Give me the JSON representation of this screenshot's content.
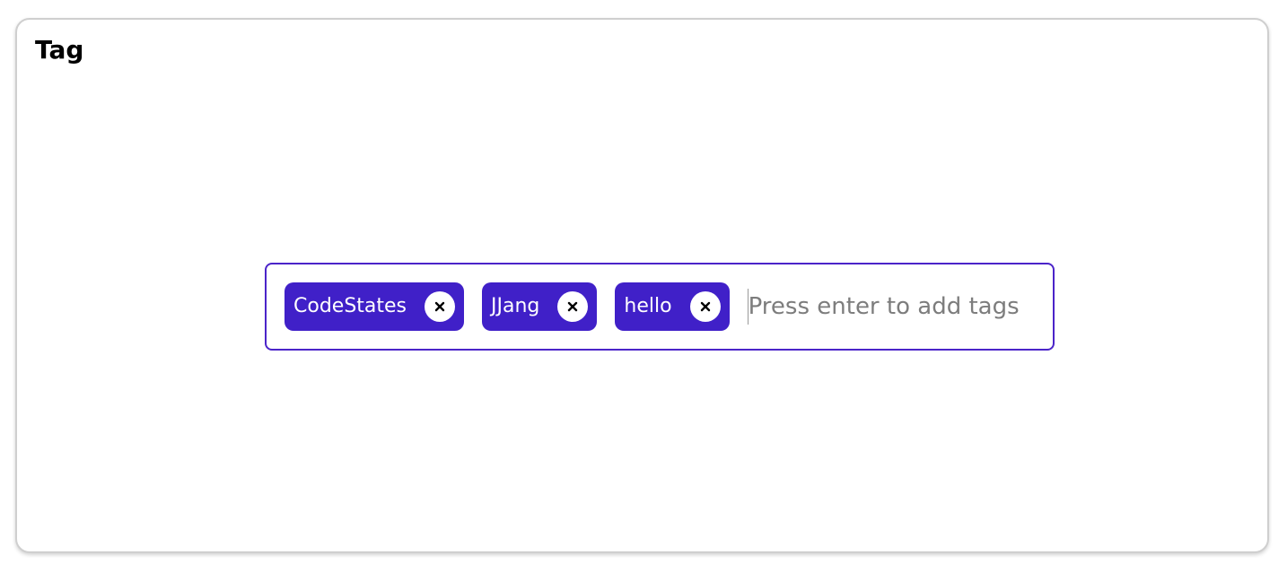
{
  "card": {
    "title": "Tag"
  },
  "tag_input": {
    "tags": [
      {
        "label": "CodeStates",
        "remove_icon": "close-icon"
      },
      {
        "label": "JJang",
        "remove_icon": "close-icon"
      },
      {
        "label": "hello",
        "remove_icon": "close-icon"
      }
    ],
    "placeholder": "Press enter to add tags",
    "value": ""
  },
  "colors": {
    "accent": "#4020c8",
    "border": "#4b24c9",
    "card_border": "#cfcfcf",
    "placeholder": "#7d7d7d"
  }
}
